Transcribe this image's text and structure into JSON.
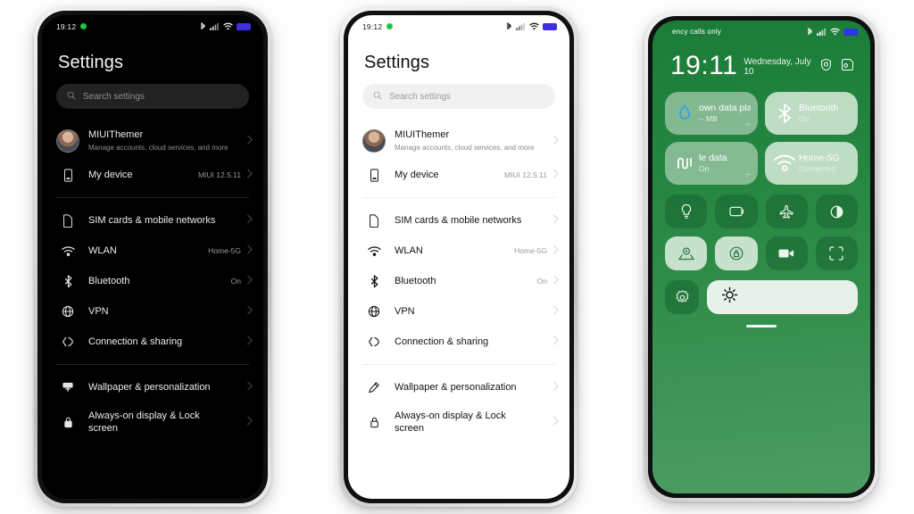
{
  "background_color": "#fdfdfd",
  "phones": {
    "phone1": {
      "name": "settings-dark",
      "statusbar": {
        "time": "19:12",
        "indicator": "green-dot",
        "icons": [
          "bluetooth-icon",
          "signal-icon",
          "wifi-icon",
          "battery-icon"
        ]
      },
      "title": "Settings",
      "search": {
        "placeholder": "Search settings",
        "icon": "search-icon"
      },
      "account": {
        "name": "MIUIThemer",
        "subtitle": "Manage accounts, cloud services, and more",
        "avatar": "user-avatar"
      },
      "rows": [
        {
          "icon": "phone-icon",
          "label": "My device",
          "value": "MIUI 12.5.11"
        },
        {
          "icon": "sim-card-icon",
          "label": "SIM cards & mobile networks",
          "value": ""
        },
        {
          "icon": "wifi-icon",
          "label": "WLAN",
          "value": "Home-5G"
        },
        {
          "icon": "bluetooth-icon",
          "label": "Bluetooth",
          "value": "On"
        },
        {
          "icon": "globe-icon",
          "label": "VPN",
          "value": ""
        },
        {
          "icon": "connection-sharing-icon",
          "label": "Connection & sharing",
          "value": ""
        },
        {
          "icon": "wallpaper-icon",
          "label": "Wallpaper & personalization",
          "value": ""
        },
        {
          "icon": "lock-icon",
          "label": "Always-on display & Lock screen",
          "value": ""
        }
      ]
    },
    "phone2": {
      "name": "settings-light",
      "statusbar": {
        "time": "19:12",
        "indicator": "green-dot",
        "icons": [
          "bluetooth-icon",
          "signal-icon",
          "wifi-icon",
          "battery-icon"
        ]
      },
      "title": "Settings",
      "search": {
        "placeholder": "Search settings",
        "icon": "search-icon"
      },
      "account": {
        "name": "MIUIThemer",
        "subtitle": "Manage accounts, cloud services, and more",
        "avatar": "user-avatar"
      },
      "rows": [
        {
          "icon": "phone-icon",
          "label": "My device",
          "value": "MIUI 12.5.11"
        },
        {
          "icon": "sim-card-icon",
          "label": "SIM cards & mobile networks",
          "value": ""
        },
        {
          "icon": "wifi-icon",
          "label": "WLAN",
          "value": "Home-5G"
        },
        {
          "icon": "bluetooth-icon",
          "label": "Bluetooth",
          "value": "On"
        },
        {
          "icon": "globe-icon",
          "label": "VPN",
          "value": ""
        },
        {
          "icon": "connection-sharing-icon",
          "label": "Connection & sharing",
          "value": ""
        },
        {
          "icon": "wallpaper-icon",
          "label": "Wallpaper & personalization",
          "value": ""
        },
        {
          "icon": "lock-icon",
          "label": "Always-on display & Lock screen",
          "value": ""
        }
      ]
    },
    "phone3": {
      "name": "control-center",
      "statusbar": {
        "carrier": "ency calls only",
        "icons": [
          "bluetooth-icon",
          "signal-icon",
          "wifi-icon",
          "battery-icon"
        ]
      },
      "clock": {
        "time": "19:11",
        "date": "Wednesday, July 10",
        "icons": [
          "shield-check-icon",
          "note-icon"
        ]
      },
      "big_tiles": [
        {
          "title": "own data plan",
          "state": "-- MB",
          "icon": "water-drop-icon",
          "active": false
        },
        {
          "title": "Bluetooth",
          "state": "On",
          "icon": "bluetooth-icon",
          "active": true
        },
        {
          "title": "le data",
          "state": "On",
          "icon": "mobile-data-icon",
          "active": false
        },
        {
          "title": "Home-5G",
          "state": "Connected",
          "icon": "wifi-icon",
          "active": true
        }
      ],
      "mini_tiles": [
        {
          "icon": "flashlight-icon",
          "active": false
        },
        {
          "icon": "do-not-disturb-icon",
          "active": false
        },
        {
          "icon": "airplane-mode-icon",
          "active": false
        },
        {
          "icon": "dark-mode-icon",
          "active": false
        },
        {
          "icon": "location-icon",
          "active": true
        },
        {
          "icon": "lock-rotation-icon",
          "active": true
        },
        {
          "icon": "screen-recorder-icon",
          "active": false
        },
        {
          "icon": "screenshot-icon",
          "active": false
        }
      ],
      "settings_tile": {
        "icon": "gear-icon"
      },
      "brightness": {
        "icon": "brightness-icon"
      },
      "drag_handle": "drag-handle"
    }
  },
  "colors": {
    "green_top": "#1b7c38",
    "green_bottom": "#4d9d63",
    "battery": "#3d2fe0",
    "status_dot": "#20c44a",
    "water_drop": "#2aa3ef"
  }
}
